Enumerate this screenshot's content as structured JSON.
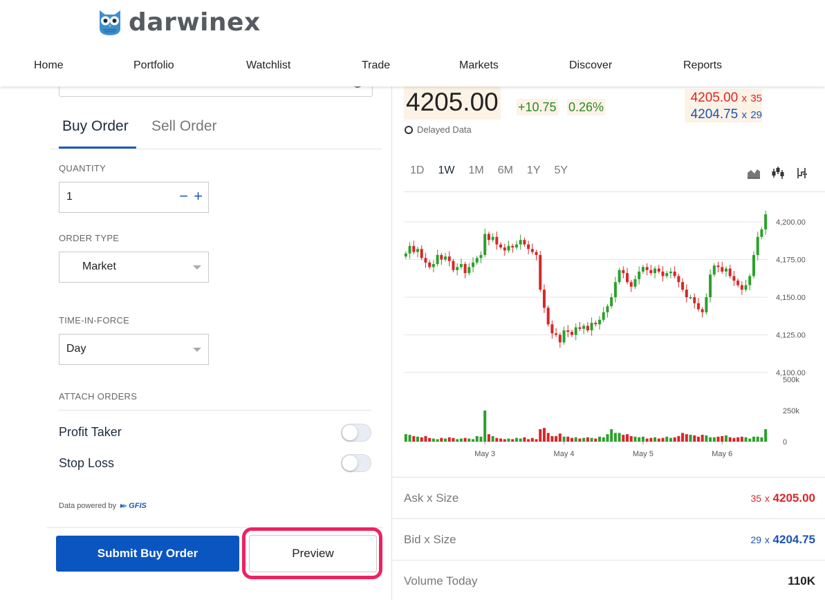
{
  "brand": {
    "name": "darwinex"
  },
  "nav": [
    {
      "label": "Home"
    },
    {
      "label": "Portfolio"
    },
    {
      "label": "Watchlist"
    },
    {
      "label": "Trade"
    },
    {
      "label": "Markets"
    },
    {
      "label": "Discover"
    },
    {
      "label": "Reports"
    }
  ],
  "order": {
    "tabs": [
      {
        "label": "Buy Order",
        "active": true
      },
      {
        "label": "Sell Order",
        "active": false
      }
    ],
    "quantity_label": "QUANTITY",
    "quantity_value": "1",
    "minus": "−",
    "plus": "+",
    "order_type_label": "ORDER TYPE",
    "order_type_value": "Market",
    "tif_label": "TIME-IN-FORCE",
    "tif_value": "Day",
    "attach_label": "ATTACH ORDERS",
    "profit_taker_label": "Profit Taker",
    "profit_taker_on": false,
    "stop_loss_label": "Stop Loss",
    "stop_loss_on": false,
    "powered_by": "Data powered by",
    "powered_brand": "GFIS",
    "submit_label": "Submit Buy Order",
    "preview_label": "Preview"
  },
  "quote": {
    "last": "4205.00",
    "change": "+10.75",
    "change_pct": "0.26%",
    "delayed": "Delayed Data",
    "ask_price": "4205.00",
    "ask_size": "35",
    "bid_price": "4204.75",
    "bid_size": "29",
    "x": "x"
  },
  "ranges": [
    {
      "label": "1D",
      "active": false
    },
    {
      "label": "1W",
      "active": true
    },
    {
      "label": "1M",
      "active": false
    },
    {
      "label": "6M",
      "active": false
    },
    {
      "label": "1Y",
      "active": false
    },
    {
      "label": "5Y",
      "active": false
    }
  ],
  "chart_icons": [
    "area-chart-icon",
    "candlestick-chart-icon",
    "step-chart-icon"
  ],
  "colors": {
    "up": "#2ca02c",
    "down": "#d62728",
    "accent": "#0b55c1",
    "highlight": "#f0215f"
  },
  "chart_data": {
    "type": "candlestick",
    "price_ticks": [
      "4,200.00",
      "4,175.00",
      "4,150.00",
      "4,125.00",
      "4,100.00"
    ],
    "price_tick_values": [
      4200,
      4175,
      4150,
      4125,
      4100
    ],
    "volume_ticks": [
      "500k",
      "250k",
      "0"
    ],
    "volume_tick_values": [
      500000,
      250000,
      0
    ],
    "x_labels": [
      "May 3",
      "May 4",
      "May 5",
      "May 6"
    ],
    "x_label_index": [
      20,
      40,
      60,
      80
    ],
    "closes": [
      4179,
      4184,
      4180,
      4182,
      4176,
      4173,
      4170,
      4172,
      4178,
      4175,
      4177,
      4174,
      4168,
      4170,
      4172,
      4166,
      4170,
      4173,
      4176,
      4178,
      4192,
      4188,
      4190,
      4185,
      4183,
      4181,
      4184,
      4183,
      4185,
      4188,
      4185,
      4182,
      4180,
      4178,
      4155,
      4143,
      4132,
      4126,
      4125,
      4120,
      4128,
      4127,
      4125,
      4130,
      4129,
      4131,
      4128,
      4133,
      4132,
      4135,
      4140,
      4144,
      4150,
      4160,
      4168,
      4166,
      4160,
      4157,
      4162,
      4167,
      4170,
      4168,
      4166,
      4169,
      4167,
      4164,
      4166,
      4167,
      4164,
      4160,
      4155,
      4150,
      4150,
      4146,
      4142,
      4140,
      4150,
      4165,
      4171,
      4170,
      4167,
      4169,
      4164,
      4161,
      4158,
      4155,
      4158,
      4164,
      4178,
      4190,
      4195,
      4205
    ],
    "volume_k": [
      60,
      55,
      45,
      40,
      35,
      45,
      30,
      25,
      20,
      30,
      25,
      35,
      30,
      20,
      25,
      30,
      25,
      20,
      45,
      40,
      250,
      60,
      45,
      30,
      25,
      20,
      25,
      20,
      30,
      25,
      35,
      20,
      30,
      20,
      100,
      110,
      70,
      45,
      45,
      65,
      40,
      40,
      30,
      35,
      25,
      30,
      35,
      30,
      25,
      40,
      35,
      60,
      100,
      70,
      70,
      55,
      60,
      45,
      40,
      35,
      40,
      25,
      30,
      35,
      25,
      30,
      40,
      30,
      35,
      45,
      70,
      60,
      55,
      50,
      40,
      55,
      50,
      35,
      35,
      40,
      45,
      50,
      35,
      30,
      35,
      40,
      35,
      25,
      40,
      40,
      35,
      100
    ]
  },
  "stats": [
    {
      "label": "Ask x Size",
      "size": "35",
      "price": "4205.00",
      "color": "ask"
    },
    {
      "label": "Bid x Size",
      "size": "29",
      "price": "4204.75",
      "color": "bid"
    },
    {
      "label": "Volume Today",
      "value": "110K"
    }
  ]
}
